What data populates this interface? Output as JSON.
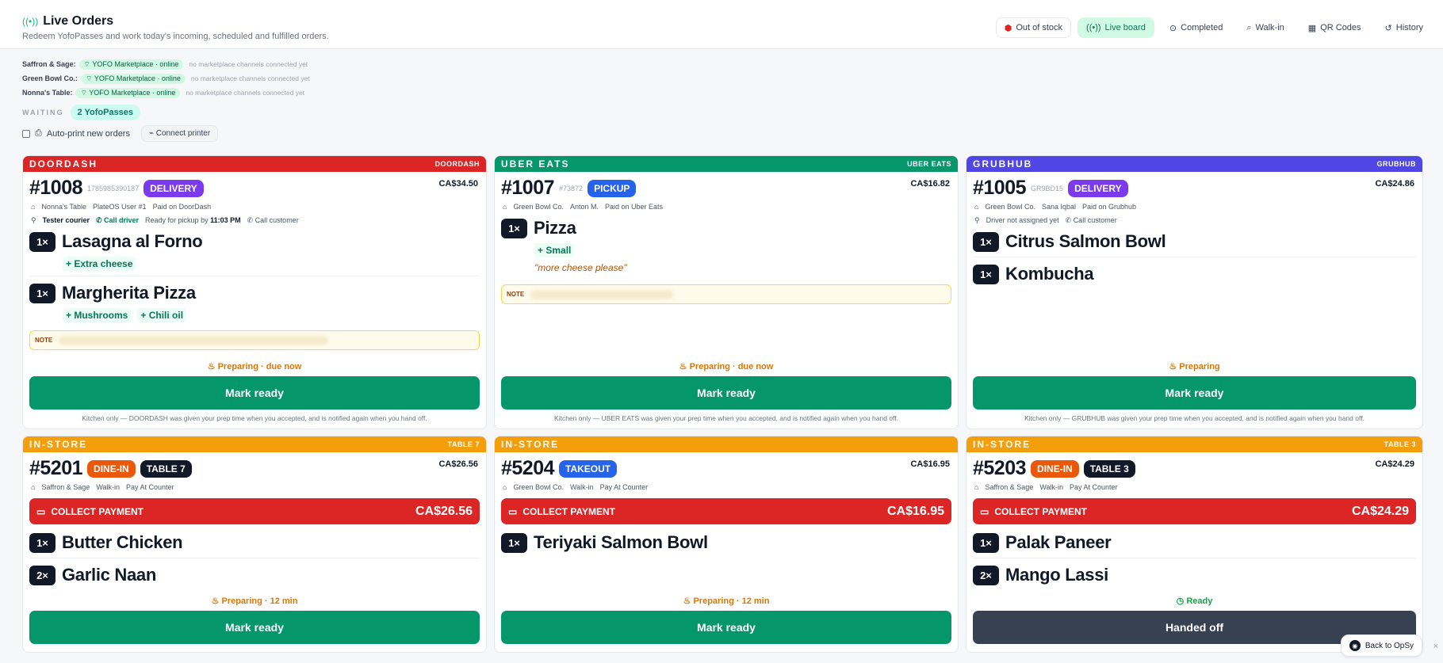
{
  "header": {
    "title": "Live Orders",
    "subtitle": "Redeem YofoPasses and work today's incoming, scheduled and fulfilled orders."
  },
  "nav": {
    "out_of_stock": "Out of stock",
    "live_board": "Live board",
    "completed": "Completed",
    "walk_in": "Walk-in",
    "qr_codes": "QR Codes",
    "history": "History"
  },
  "stores": [
    {
      "name": "Saffron & Sage:",
      "chip": "YOFO Marketplace · online",
      "note": "no marketplace channels connected yet"
    },
    {
      "name": "Green Bowl Co.:",
      "chip": "YOFO Marketplace · online",
      "note": "no marketplace channels connected yet"
    },
    {
      "name": "Nonna's Table:",
      "chip": "YOFO Marketplace · online",
      "note": "no marketplace channels connected yet"
    }
  ],
  "waiting": {
    "label": "WAITING",
    "chip": "2 YofoPasses"
  },
  "print": {
    "auto": "Auto-print new orders",
    "connect": "Connect printer"
  },
  "orders": [
    {
      "band": "DOORDASH",
      "code": "DOORDASH",
      "num": "#1008",
      "ext": "1785985390187",
      "pill": "DELIVERY",
      "total": "CA$34.50",
      "meta1": [
        "Nonna's Table",
        "PlateOS User #1",
        "Paid on DoorDash"
      ],
      "courier": "Tester courier",
      "call_driver": "Call driver",
      "ready_by": "Ready for pickup by",
      "ready_time": "11:03 PM",
      "call_customer": "Call customer",
      "items": [
        {
          "qty": "1×",
          "name": "Lasagna al Forno",
          "mods": [
            "+ Extra cheese"
          ]
        },
        {
          "qty": "1×",
          "name": "Margherita Pizza",
          "mods": [
            "+ Mushrooms",
            "+ Chili oil"
          ]
        }
      ],
      "note_label": "NOTE",
      "status": "Preparing · due now",
      "button": "Mark ready",
      "fine": "Kitchen only — DOORDASH was given your prep time when you accepted, and is notified again when you hand off."
    },
    {
      "band": "UBER EATS",
      "code": "UBER EATS",
      "num": "#1007",
      "ext": "#73872",
      "pill": "PICKUP",
      "total": "CA$16.82",
      "meta1": [
        "Green Bowl Co.",
        "Anton M.",
        "Paid on Uber Eats"
      ],
      "items": [
        {
          "qty": "1×",
          "name": "Pizza",
          "mods": [
            "+ Small"
          ],
          "quote": "\"more cheese please\""
        }
      ],
      "note_label": "NOTE",
      "status": "Preparing · due now",
      "button": "Mark ready",
      "fine": "Kitchen only — UBER EATS was given your prep time when you accepted, and is notified again when you hand off."
    },
    {
      "band": "GRUBHUB",
      "code": "GRUBHUB",
      "num": "#1005",
      "ext": "GR9BD15",
      "pill": "DELIVERY",
      "total": "CA$24.86",
      "meta1": [
        "Green Bowl Co.",
        "Sana Iqbal",
        "Paid on Grubhub"
      ],
      "driver": "Driver not assigned yet",
      "call_customer": "Call customer",
      "items": [
        {
          "qty": "1×",
          "name": "Citrus Salmon Bowl"
        },
        {
          "qty": "1×",
          "name": "Kombucha"
        }
      ],
      "status": "Preparing",
      "button": "Mark ready",
      "fine": "Kitchen only — GRUBHUB was given your prep time when you accepted, and is notified again when you hand off."
    },
    {
      "band": "IN-STORE",
      "code": "TABLE 7",
      "num": "#5201",
      "pill": "DINE-IN",
      "table": "TABLE 7",
      "total": "CA$26.56",
      "meta1": [
        "Saffron & Sage",
        "Walk-in",
        "Pay At Counter"
      ],
      "collect": "COLLECT PAYMENT",
      "collect_amt": "CA$26.56",
      "items": [
        {
          "qty": "1×",
          "name": "Butter Chicken"
        },
        {
          "qty": "2×",
          "name": "Garlic Naan"
        }
      ],
      "status": "Preparing · 12 min",
      "button": "Mark ready"
    },
    {
      "band": "IN-STORE",
      "code": "",
      "num": "#5204",
      "pill": "TAKEOUT",
      "total": "CA$16.95",
      "meta1": [
        "Green Bowl Co.",
        "Walk-in",
        "Pay At Counter"
      ],
      "collect": "COLLECT PAYMENT",
      "collect_amt": "CA$16.95",
      "items": [
        {
          "qty": "1×",
          "name": "Teriyaki Salmon Bowl"
        }
      ],
      "status": "Preparing · 12 min",
      "button": "Mark ready"
    },
    {
      "band": "IN-STORE",
      "code": "TABLE 3",
      "num": "#5203",
      "pill": "DINE-IN",
      "table": "TABLE 3",
      "total": "CA$24.29",
      "meta1": [
        "Saffron & Sage",
        "Walk-in",
        "Pay At Counter"
      ],
      "collect": "COLLECT PAYMENT",
      "collect_amt": "CA$24.29",
      "items": [
        {
          "qty": "1×",
          "name": "Palak Paneer"
        },
        {
          "qty": "2×",
          "name": "Mango Lassi"
        }
      ],
      "status": "Ready",
      "button": "Handed off"
    }
  ],
  "back": {
    "label": "Back to OpSy"
  },
  "colors": {
    "doordash": "#dc2626",
    "ubereats": "#059669",
    "grubhub": "#4f46e5",
    "instore": "#f59e0b",
    "delivery": "#7c3aed",
    "pickup": "#2563eb",
    "dinein": "#ea580c",
    "table": "#111827",
    "takeout": "#2563eb"
  }
}
